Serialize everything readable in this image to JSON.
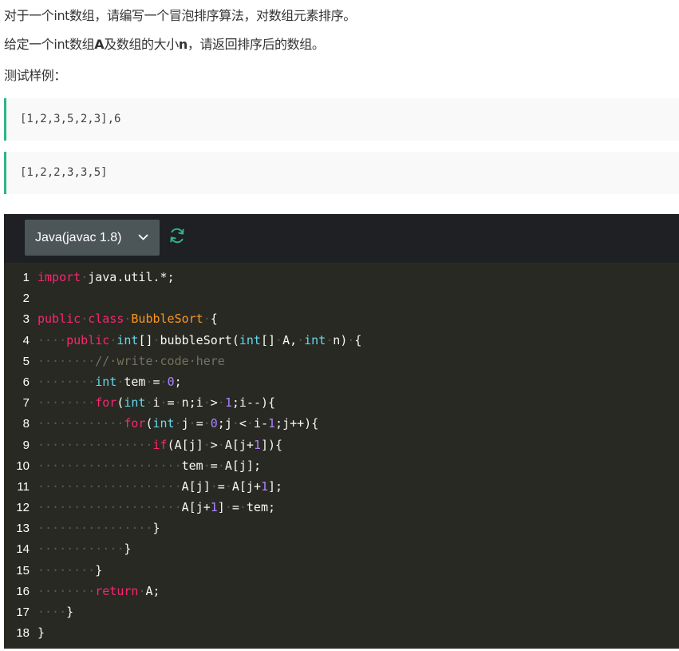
{
  "problem": {
    "line1": "对于一个int数组，请编写一个冒泡排序算法，对数组元素排序。",
    "line2_prefix": "给定一个int数组",
    "line2_bold_a": "A",
    "line2_mid": "及数组的大小",
    "line2_bold_n": "n",
    "line2_suffix": "，请返回排序后的数组。",
    "line3": "测试样例："
  },
  "samples": {
    "input": "[1,2,3,5,2,3],6",
    "output": "[1,2,2,3,3,5]"
  },
  "editor": {
    "language": "Java(javac 1.8)",
    "icons": {
      "language_dropdown": "chevron-down-icon",
      "reset": "refresh-icon"
    },
    "colors": {
      "accent": "#2fb38b",
      "background": "#282923",
      "toolbar": "#1e2023",
      "keyword": "#f92672",
      "type": "#66d9ef",
      "class": "#fd971f",
      "number": "#ae81ff",
      "comment": "#75715e"
    },
    "lines": [
      "import java.util.*;",
      "",
      "public class BubbleSort {",
      "    public int[] bubbleSort(int[] A, int n) {",
      "        // write code here",
      "        int tem = 0;",
      "        for(int i = n;i > 1;i--){",
      "            for(int j = 0;j < i-1;j++){",
      "                if(A[j] > A[j+1]){",
      "                    tem = A[j];",
      "                    A[j] = A[j+1];",
      "                    A[j+1] = tem;",
      "                }",
      "            }",
      "        }",
      "        return A;",
      "    }",
      "}"
    ]
  }
}
